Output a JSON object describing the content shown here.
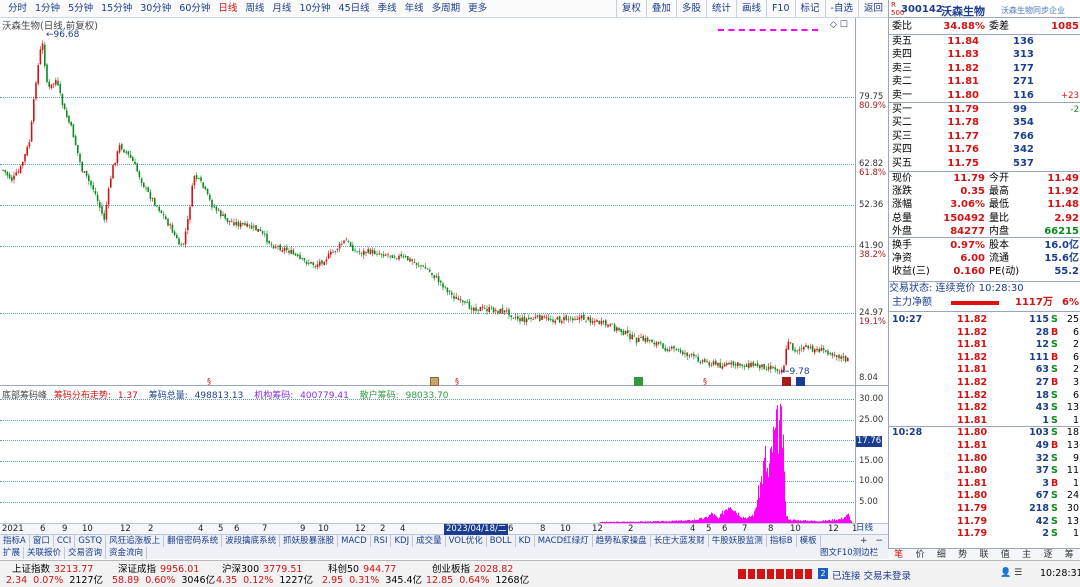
{
  "toolbar": {
    "periods": [
      "分时",
      "1分钟",
      "5分钟",
      "15分钟",
      "30分钟",
      "60分钟",
      "日线",
      "周线",
      "月线",
      "10分钟",
      "45日线",
      "季线",
      "年线",
      "多周期",
      "更多"
    ],
    "active_period": "日线",
    "right_buttons": [
      "复权",
      "叠加",
      "多股",
      "统计",
      "画线",
      "F10",
      "标记",
      "-自选",
      "返回"
    ]
  },
  "chart": {
    "title": "沃森生物(日线,前复权)",
    "price_axis": [
      {
        "value": "79.75",
        "pct": "80.9%"
      },
      {
        "value": "62.82",
        "pct": "61.8%"
      },
      {
        "value": "52.36",
        "pct": ""
      },
      {
        "value": "41.90",
        "pct": "38.2%"
      },
      {
        "value": "24.97",
        "pct": "19.1%"
      },
      {
        "value": "8.04",
        "pct": ""
      }
    ],
    "high_label": "96.68",
    "low_label": "9.78",
    "volume_axis": [
      "30.00",
      "25.00",
      "20.00",
      "15.00",
      "10.00",
      "5.00"
    ],
    "volume_current": "17.76",
    "volume_legend": {
      "name": "底部筹码峰",
      "trend_label": "筹码分布走势:",
      "trend_value": "1.37",
      "total_label": "筹码总量:",
      "total_value": "498813.13",
      "inst_label": "机构筹码:",
      "inst_value": "400779.41",
      "retail_label": "散户筹码:",
      "retail_value": "98033.70"
    },
    "time_ticks": [
      "2021",
      "6",
      "9",
      "10",
      "12",
      "2",
      "4",
      "5",
      "6",
      "7",
      "9",
      "10",
      "12",
      "2",
      "4",
      "2023/04/18/二",
      "6",
      "8",
      "10",
      "12",
      "2",
      "4",
      "5",
      "6",
      "7",
      "8",
      "10",
      "12",
      "1"
    ],
    "time_highlight": "2023/04/18/二",
    "time_right": "日线",
    "indicator_tabs": [
      "指标A",
      "窗口",
      "CCI",
      "GSTQ",
      "风狂追涨板上",
      "翻倍密码系统",
      "波段擒底系统",
      "抓妖股暴涨股",
      "MACD",
      "RSI",
      "KDJ",
      "成交量",
      "VOL优化",
      "BOLL",
      "KD",
      "MACD红绿灯",
      "趋势私家操盘",
      "长庄大蓝发财",
      "牛股妖股监测",
      "指标B",
      "模板"
    ],
    "bottom_tabs": [
      "扩展",
      "关联报价",
      "交易咨询",
      "资金流向"
    ]
  },
  "stock": {
    "code": "300142",
    "name": "沃森生物",
    "tag": "沃森生物同步企业",
    "weibi_label": "委比",
    "weibi": "34.88%",
    "weicha_label": "委差",
    "weicha": "1085",
    "asks": [
      {
        "label": "卖五",
        "price": "11.84",
        "vol": "136",
        "chg": ""
      },
      {
        "label": "卖四",
        "price": "11.83",
        "vol": "313",
        "chg": ""
      },
      {
        "label": "卖三",
        "price": "11.82",
        "vol": "177",
        "chg": ""
      },
      {
        "label": "卖二",
        "price": "11.81",
        "vol": "271",
        "chg": ""
      },
      {
        "label": "卖一",
        "price": "11.80",
        "vol": "116",
        "chg": "+23"
      }
    ],
    "bids": [
      {
        "label": "买一",
        "price": "11.79",
        "vol": "99",
        "chg": "-2"
      },
      {
        "label": "买二",
        "price": "11.78",
        "vol": "354",
        "chg": ""
      },
      {
        "label": "买三",
        "price": "11.77",
        "vol": "766",
        "chg": ""
      },
      {
        "label": "买四",
        "price": "11.76",
        "vol": "342",
        "chg": ""
      },
      {
        "label": "买五",
        "price": "11.75",
        "vol": "537",
        "chg": ""
      }
    ],
    "quote": [
      {
        "l1": "现价",
        "v1": "11.79",
        "l2": "今开",
        "v2": "11.49"
      },
      {
        "l1": "涨跌",
        "v1": "0.35",
        "l2": "最高",
        "v2": "11.92"
      },
      {
        "l1": "涨幅",
        "v1": "3.06%",
        "l2": "最低",
        "v2": "11.48"
      },
      {
        "l1": "总量",
        "v1": "150492",
        "l2": "量比",
        "v2": "2.92"
      },
      {
        "l1": "外盘",
        "v1": "84277",
        "l2": "内盘",
        "v2": "66215"
      }
    ],
    "quote2": [
      {
        "l1": "换手",
        "v1": "0.97%",
        "l2": "股本",
        "v2": "16.0亿"
      },
      {
        "l1": "净资",
        "v1": "6.00",
        "l2": "流通",
        "v2": "15.6亿"
      },
      {
        "l1": "收益(三)",
        "v1": "0.160",
        "l2": "PE(动)",
        "v2": "55.2"
      }
    ],
    "trade_status": "交易状态: 连续竞价 10:28:30",
    "main_flow_label": "主力净额",
    "main_flow_value": "1117万",
    "main_flow_pct": "6%"
  },
  "ticks": [
    {
      "t": "10:27",
      "p": "11.82",
      "v": "115",
      "bs": "S",
      "n": "25"
    },
    {
      "t": "",
      "p": "11.82",
      "v": "28",
      "bs": "B",
      "n": "6"
    },
    {
      "t": "",
      "p": "11.81",
      "v": "12",
      "bs": "S",
      "n": "2"
    },
    {
      "t": "",
      "p": "11.82",
      "v": "111",
      "bs": "B",
      "n": "6"
    },
    {
      "t": "",
      "p": "11.81",
      "v": "63",
      "bs": "S",
      "n": "2"
    },
    {
      "t": "",
      "p": "11.82",
      "v": "27",
      "bs": "B",
      "n": "3"
    },
    {
      "t": "",
      "p": "11.82",
      "v": "18",
      "bs": "S",
      "n": "6"
    },
    {
      "t": "",
      "p": "11.82",
      "v": "43",
      "bs": "S",
      "n": "13"
    },
    {
      "t": "",
      "p": "11.81",
      "v": "1",
      "bs": "S",
      "n": "1"
    },
    {
      "t": "10:28",
      "p": "11.80",
      "v": "103",
      "bs": "S",
      "n": "18"
    },
    {
      "t": "",
      "p": "11.81",
      "v": "49",
      "bs": "B",
      "n": "13"
    },
    {
      "t": "",
      "p": "11.80",
      "v": "32",
      "bs": "S",
      "n": "9"
    },
    {
      "t": "",
      "p": "11.80",
      "v": "37",
      "bs": "S",
      "n": "11"
    },
    {
      "t": "",
      "p": "11.81",
      "v": "3",
      "bs": "B",
      "n": "1"
    },
    {
      "t": "",
      "p": "11.80",
      "v": "67",
      "bs": "S",
      "n": "24"
    },
    {
      "t": "",
      "p": "11.79",
      "v": "218",
      "bs": "S",
      "n": "30"
    },
    {
      "t": "",
      "p": "11.79",
      "v": "42",
      "bs": "S",
      "n": "13"
    },
    {
      "t": "",
      "p": "11.79",
      "v": "2",
      "bs": "S",
      "n": "1"
    }
  ],
  "right_tabs": [
    "笔",
    "价",
    "细",
    "势",
    "联",
    "值",
    "主",
    "逐",
    "筹"
  ],
  "right_tab_active": "笔",
  "right_top_tabs": [
    "图文F10",
    "测边栏",
    "+",
    "−"
  ],
  "indices": [
    {
      "name": "上证指数",
      "value": "3213.77",
      "chg": "2.34",
      "pct": "0.07%",
      "amt": "2127亿"
    },
    {
      "name": "深证成指",
      "value": "9956.01",
      "chg": "58.89",
      "pct": "0.60%",
      "amt": "3046亿"
    },
    {
      "name": "沪深300",
      "value": "3779.51",
      "chg": "4.35",
      "pct": "0.12%",
      "amt": "1227亿"
    },
    {
      "name": "科创50",
      "value": "944.77",
      "chg": "2.95",
      "pct": "0.31%",
      "amt": "345.4亿"
    },
    {
      "name": "创业板指",
      "value": "2028.82",
      "chg": "12.85",
      "pct": "0.64%",
      "amt": "1268亿"
    }
  ],
  "status": {
    "connection": "已连接 交易未登录",
    "clock": "10:28:31"
  },
  "colors": {
    "up": "#d41212",
    "down": "#0a8a1a",
    "volume": "#ff00ff",
    "grid": "#5aa0c8"
  }
}
